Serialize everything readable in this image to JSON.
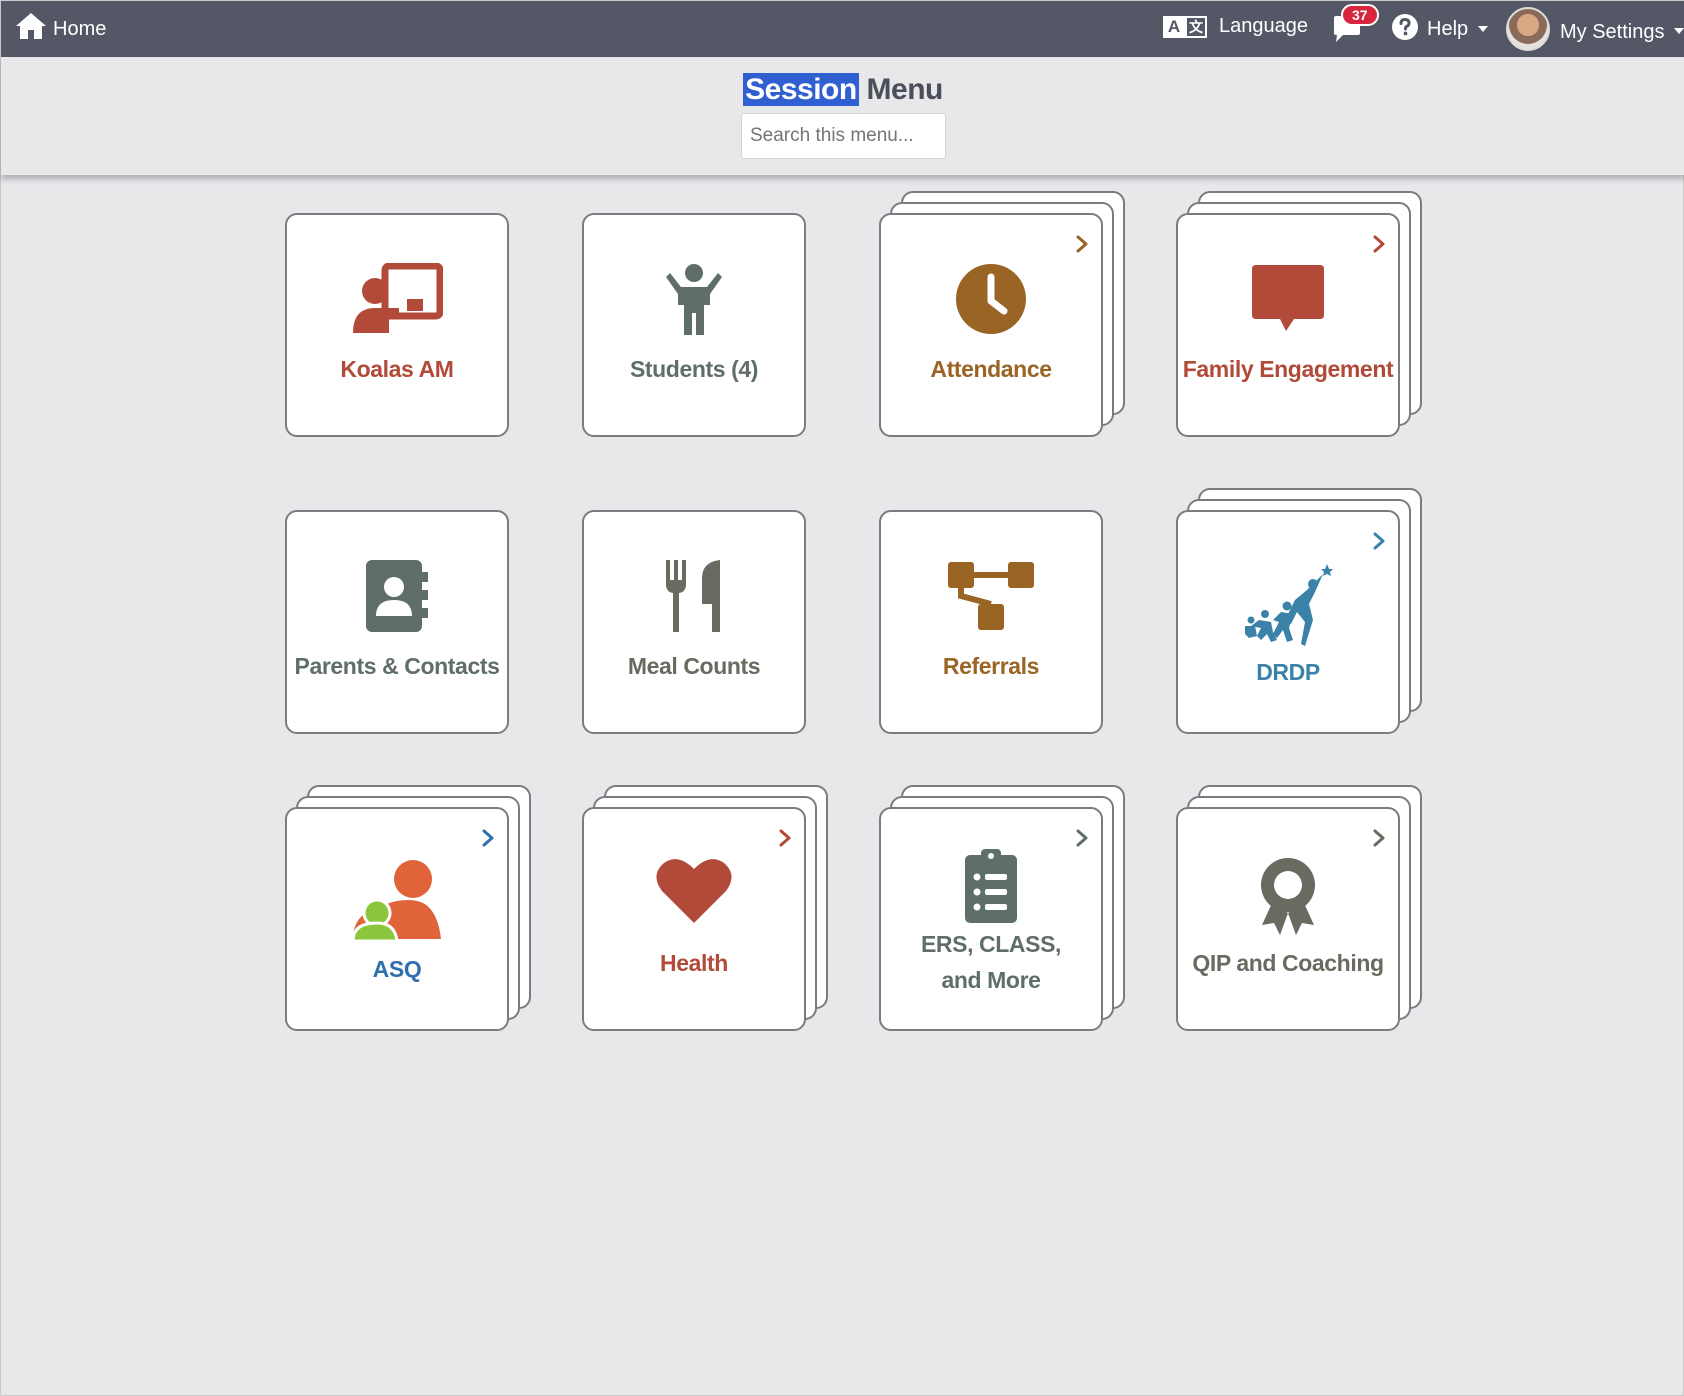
{
  "nav": {
    "home_label": "Home",
    "language_label": "Language",
    "messages_count": "37",
    "help_label": "Help",
    "settings_label": "My Settings"
  },
  "header": {
    "title_selected": "Session",
    "title_rest": "Menu",
    "search_placeholder": "Search this menu..."
  },
  "tiles": [
    {
      "label": "Koalas AM",
      "color": "#b24a39",
      "icon": "teacher-icon",
      "submenu": false
    },
    {
      "label": "Students (4)",
      "color": "#5f6e6a",
      "icon": "child-icon",
      "submenu": false
    },
    {
      "label": "Attendance",
      "color": "#9a6424",
      "icon": "clock-icon",
      "submenu": true
    },
    {
      "label": "Family Engagement",
      "color": "#b24a39",
      "icon": "speech-bubble-icon",
      "submenu": true
    },
    {
      "label": "Parents & Contacts",
      "color": "#5f6e6a",
      "icon": "address-book-icon",
      "submenu": false
    },
    {
      "label": "Meal Counts",
      "color": "#6b6a60",
      "icon": "utensils-icon",
      "submenu": false
    },
    {
      "label": "Referrals",
      "color": "#9a6424",
      "icon": "sitemap-icon",
      "submenu": false
    },
    {
      "label": "DRDP",
      "color": "#3a82a8",
      "icon": "drdp-logo-icon",
      "submenu": true
    },
    {
      "label": "ASQ",
      "color": "#2f6fb0",
      "icon": "asq-logo-icon",
      "submenu": true
    },
    {
      "label": "Health",
      "color": "#b24a39",
      "icon": "heart-icon",
      "submenu": true
    },
    {
      "label": "ERS, CLASS, and More",
      "color": "#5f6e6a",
      "icon": "clipboard-list-icon",
      "submenu": true
    },
    {
      "label": "QIP and Coaching",
      "color": "#6b6a60",
      "icon": "award-icon",
      "submenu": true
    }
  ]
}
